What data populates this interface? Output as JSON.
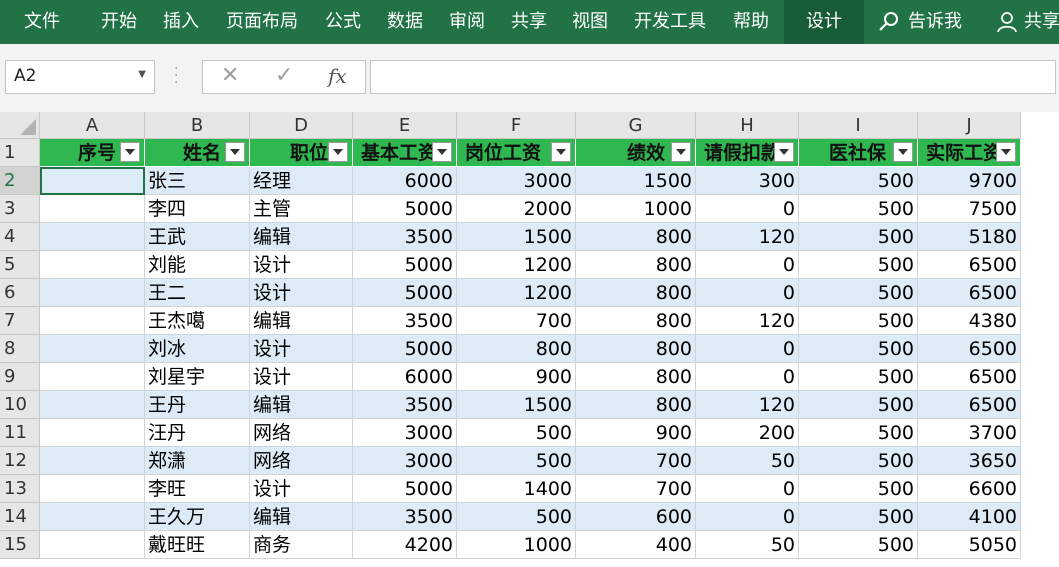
{
  "ribbon": {
    "tabs": [
      {
        "id": "file",
        "label": "文件"
      },
      {
        "id": "home",
        "label": "开始"
      },
      {
        "id": "insert",
        "label": "插入"
      },
      {
        "id": "layout",
        "label": "页面布局"
      },
      {
        "id": "formulas",
        "label": "公式"
      },
      {
        "id": "data",
        "label": "数据"
      },
      {
        "id": "review",
        "label": "审阅"
      },
      {
        "id": "share",
        "label": "共享"
      },
      {
        "id": "view",
        "label": "视图"
      },
      {
        "id": "developer",
        "label": "开发工具"
      },
      {
        "id": "help",
        "label": "帮助"
      },
      {
        "id": "design",
        "label": "设计"
      }
    ],
    "active_tab": "设计",
    "tell_me": "告诉我",
    "share_label": "共享",
    "color": "#217346",
    "active_color": "#185c37"
  },
  "formula_bar": {
    "name_box": "A2",
    "cancel_icon": "✕",
    "enter_icon": "✓",
    "fx_label": "fx",
    "formula": ""
  },
  "sheet": {
    "column_headers": [
      "A",
      "B",
      "D",
      "E",
      "F",
      "G",
      "H",
      "I",
      "J"
    ],
    "row_numbers": [
      "1",
      "2",
      "3",
      "4",
      "5",
      "6",
      "7",
      "8",
      "9",
      "10",
      "11",
      "12",
      "13",
      "14",
      "15"
    ],
    "selected_cell": "A2",
    "header_color": "#2eb84f",
    "band_color": "#ddebf7",
    "table_headers": [
      "序号",
      "姓名",
      "职位",
      "基本工资",
      "岗位工资",
      "绩效",
      "请假扣款",
      "医社保",
      "实际工资"
    ],
    "rows": [
      [
        "",
        "张三",
        "经理",
        "6000",
        "3000",
        "1500",
        "300",
        "500",
        "9700"
      ],
      [
        "",
        "李四",
        "主管",
        "5000",
        "2000",
        "1000",
        "0",
        "500",
        "7500"
      ],
      [
        "",
        "王武",
        "编辑",
        "3500",
        "1500",
        "800",
        "120",
        "500",
        "5180"
      ],
      [
        "",
        "刘能",
        "设计",
        "5000",
        "1200",
        "800",
        "0",
        "500",
        "6500"
      ],
      [
        "",
        "王二",
        "设计",
        "5000",
        "1200",
        "800",
        "0",
        "500",
        "6500"
      ],
      [
        "",
        "王杰噶",
        "编辑",
        "3500",
        "700",
        "800",
        "120",
        "500",
        "4380"
      ],
      [
        "",
        "刘冰",
        "设计",
        "5000",
        "800",
        "800",
        "0",
        "500",
        "6500"
      ],
      [
        "",
        "刘星宇",
        "设计",
        "6000",
        "900",
        "800",
        "0",
        "500",
        "6500"
      ],
      [
        "",
        "王丹",
        "编辑",
        "3500",
        "1500",
        "800",
        "120",
        "500",
        "6500"
      ],
      [
        "",
        "汪丹",
        "网络",
        "3000",
        "500",
        "900",
        "200",
        "500",
        "3700"
      ],
      [
        "",
        "郑潇",
        "网络",
        "3000",
        "500",
        "700",
        "50",
        "500",
        "3650"
      ],
      [
        "",
        "李旺",
        "设计",
        "5000",
        "1400",
        "700",
        "0",
        "500",
        "6600"
      ],
      [
        "",
        "王久万",
        "编辑",
        "3500",
        "500",
        "600",
        "0",
        "500",
        "4100"
      ],
      [
        "",
        "戴旺旺",
        "商务",
        "4200",
        "1000",
        "400",
        "50",
        "500",
        "5050"
      ]
    ]
  }
}
